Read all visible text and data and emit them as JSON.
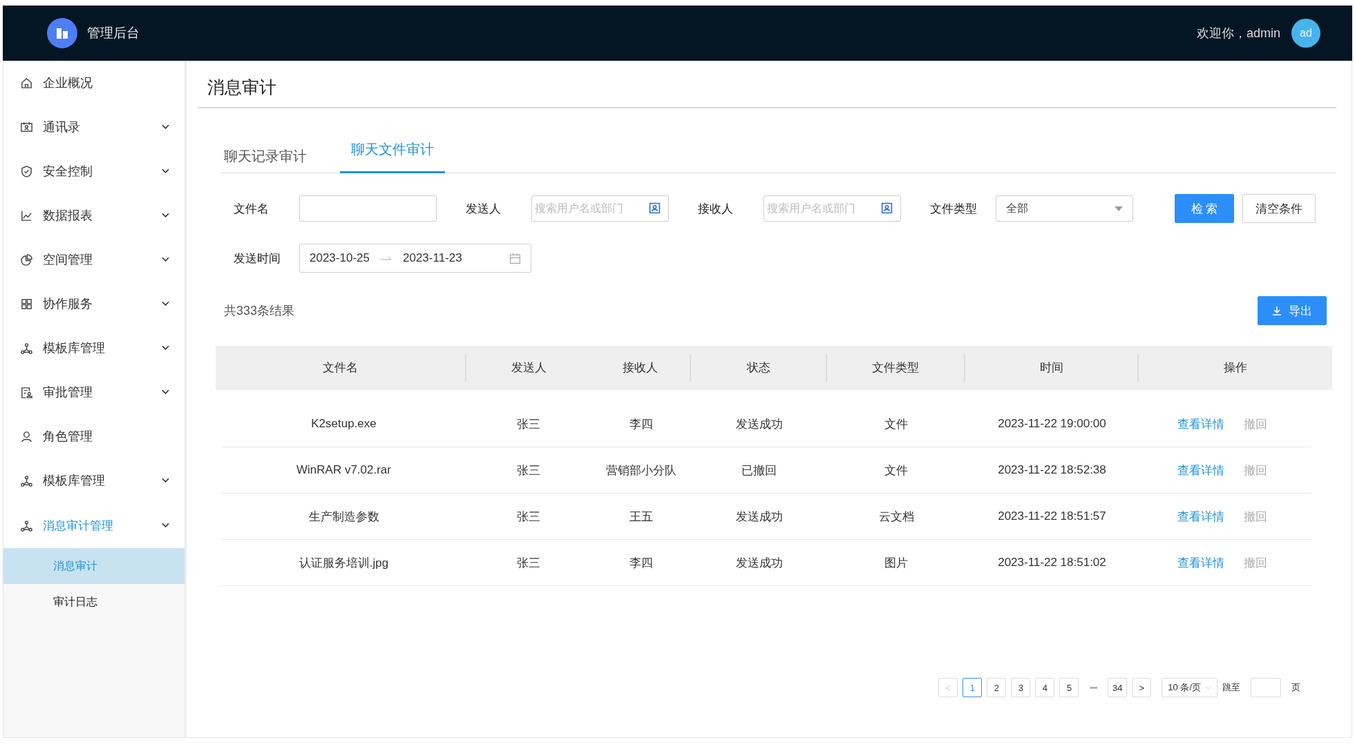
{
  "header": {
    "app_name": "管理后台",
    "welcome": "欢迎你，admin",
    "avatar": "ad"
  },
  "sidebar": {
    "items": [
      {
        "label": "企业概况",
        "kind": "home",
        "expandable": false,
        "expanded": false
      },
      {
        "label": "通讯录",
        "kind": "contacts",
        "expandable": true,
        "expanded": false
      },
      {
        "label": "安全控制",
        "kind": "shield",
        "expandable": true,
        "expanded": false
      },
      {
        "label": "数据报表",
        "kind": "chart",
        "expandable": true,
        "expanded": false
      },
      {
        "label": "空间管理",
        "kind": "pie",
        "expandable": true,
        "expanded": false
      },
      {
        "label": "协作服务",
        "kind": "grid",
        "expandable": true,
        "expanded": false
      },
      {
        "label": "模板库管理",
        "kind": "nodes",
        "expandable": true,
        "expanded": false
      },
      {
        "label": "审批管理",
        "kind": "approval",
        "expandable": true,
        "expanded": false
      },
      {
        "label": "角色管理",
        "kind": "user",
        "expandable": false,
        "expanded": false
      },
      {
        "label": "模板库管理",
        "kind": "nodes",
        "expandable": true,
        "expanded": false
      },
      {
        "label": "消息审计管理",
        "kind": "nodes",
        "expandable": true,
        "expanded": true,
        "children": [
          {
            "label": "消息审计",
            "selected": true
          },
          {
            "label": "审计日志",
            "selected": false
          }
        ]
      }
    ]
  },
  "page_title": "消息审计",
  "tabs": [
    {
      "label": "聊天记录审计",
      "selected": false
    },
    {
      "label": "聊天文件审计",
      "selected": true
    }
  ],
  "filters": {
    "file_name": {
      "label": "文件名"
    },
    "sender": {
      "label": "发送人",
      "placeholder": "搜索用户名或部门"
    },
    "receiver": {
      "label": "接收人",
      "placeholder": "搜索用户名或部门"
    },
    "file_type": {
      "label": "文件类型",
      "value": "全部"
    },
    "send_time": {
      "label": "发送时间",
      "start": "2023-10-25",
      "end": "2023-11-23"
    }
  },
  "buttons": {
    "search": "检 索",
    "clear": "清空条件",
    "export": "导出"
  },
  "result_count": "共333条结果",
  "table": {
    "columns": [
      "文件名",
      "发送人",
      "接收人",
      "状态",
      "文件类型",
      "时间",
      "操作"
    ],
    "rows": [
      {
        "file_name": "K2setup.exe",
        "sender": "张三",
        "receiver": "李四",
        "status": "发送成功",
        "file_type": "文件",
        "time": "2023-11-22 19:00:00",
        "actions": [
          "查看详情",
          "撤回"
        ]
      },
      {
        "file_name": "WinRAR v7.02.rar",
        "sender": "张三",
        "receiver": "营销部小分队",
        "status": "已撤回",
        "file_type": "文件",
        "time": "2023-11-22 18:52:38",
        "actions": [
          "查看详情",
          "撤回"
        ]
      },
      {
        "file_name": "生产制造参数",
        "sender": "张三",
        "receiver": "王五",
        "status": "发送成功",
        "file_type": "云文档",
        "time": "2023-11-22 18:51:57",
        "actions": [
          "查看详情",
          "撤回"
        ]
      },
      {
        "file_name": "认证服务培训.jpg",
        "sender": "张三",
        "receiver": "李四",
        "status": "发送成功",
        "file_type": "图片",
        "time": "2023-11-22 18:51:02",
        "actions": [
          "查看详情",
          "撤回"
        ]
      }
    ]
  },
  "pagination": {
    "prev": "<",
    "pages": [
      {
        "label": "1",
        "selected": true
      },
      {
        "label": "2",
        "selected": false
      },
      {
        "label": "3",
        "selected": false
      },
      {
        "label": "4",
        "selected": false
      },
      {
        "label": "5",
        "selected": false
      }
    ],
    "ellipsis": "•••",
    "last": "34",
    "next": ">",
    "page_size": "10 条/页",
    "jump_label": "跳至",
    "page_unit": "页"
  }
}
